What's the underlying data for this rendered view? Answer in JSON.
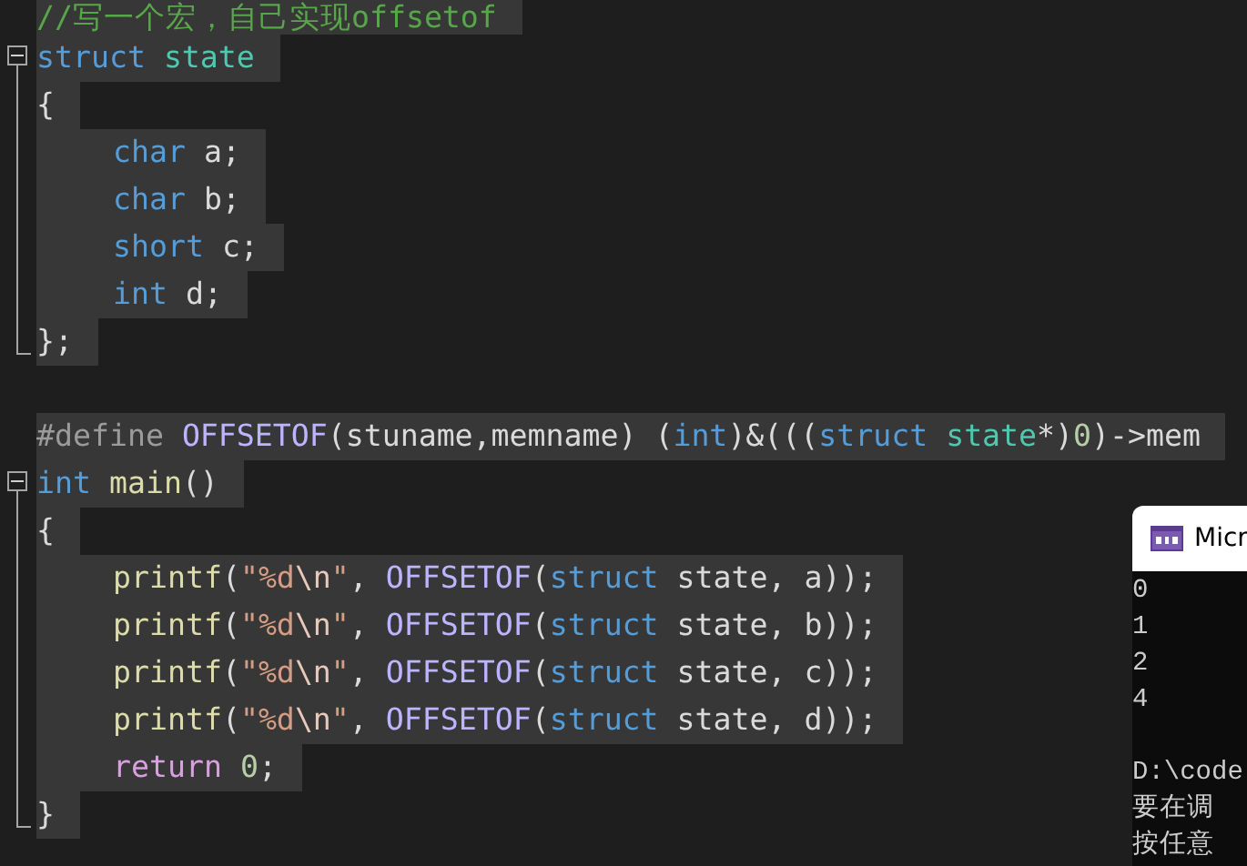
{
  "editor": {
    "lines": [
      {
        "kind": "plain",
        "selected": true,
        "tokens": [
          {
            "kind": "comment",
            "text": "//写一个宏，自己实现offsetof"
          }
        ]
      },
      {
        "kind": "start",
        "selected": true,
        "tokens": [
          {
            "kind": "keyword",
            "text": "struct "
          },
          {
            "kind": "type",
            "text": "state"
          }
        ]
      },
      {
        "kind": "body",
        "selected": true,
        "tokens": [
          {
            "kind": "plain",
            "text": "{"
          }
        ]
      },
      {
        "kind": "body",
        "selected": true,
        "indent": true,
        "tokens": [
          {
            "kind": "keyword",
            "text": "char"
          },
          {
            "kind": "plain",
            "text": " a;"
          }
        ]
      },
      {
        "kind": "body",
        "selected": true,
        "indent": true,
        "tokens": [
          {
            "kind": "keyword",
            "text": "char"
          },
          {
            "kind": "plain",
            "text": " b;"
          }
        ]
      },
      {
        "kind": "body",
        "selected": true,
        "indent": true,
        "tokens": [
          {
            "kind": "keyword",
            "text": "short"
          },
          {
            "kind": "plain",
            "text": " c;"
          }
        ]
      },
      {
        "kind": "body",
        "selected": true,
        "indent": true,
        "tokens": [
          {
            "kind": "keyword",
            "text": "int"
          },
          {
            "kind": "plain",
            "text": " d;"
          }
        ]
      },
      {
        "kind": "end",
        "selected": true,
        "tokens": [
          {
            "kind": "plain",
            "text": "};"
          }
        ]
      },
      {
        "kind": "plain"
      },
      {
        "kind": "plain",
        "selected": true,
        "tokens": [
          {
            "kind": "preproc",
            "text": "#define "
          },
          {
            "kind": "macro",
            "text": "OFFSETOF"
          },
          {
            "kind": "plain",
            "text": "(stuname,memname) ("
          },
          {
            "kind": "keyword",
            "text": "int"
          },
          {
            "kind": "plain",
            "text": ")&((("
          },
          {
            "kind": "keyword",
            "text": "struct "
          },
          {
            "kind": "type",
            "text": "state"
          },
          {
            "kind": "plain",
            "text": "*)"
          },
          {
            "kind": "number",
            "text": "0"
          },
          {
            "kind": "plain",
            "text": ")->mem"
          }
        ]
      },
      {
        "kind": "start",
        "selected": true,
        "tokens": [
          {
            "kind": "keyword",
            "text": "int "
          },
          {
            "kind": "function",
            "text": "main"
          },
          {
            "kind": "plain",
            "text": "()"
          }
        ]
      },
      {
        "kind": "body",
        "selected": true,
        "tokens": [
          {
            "kind": "plain",
            "text": "{"
          }
        ]
      },
      {
        "kind": "body",
        "selected": true,
        "indent": true,
        "tokens": [
          {
            "kind": "function",
            "text": "printf"
          },
          {
            "kind": "plain",
            "text": "("
          },
          {
            "kind": "string",
            "text": "\"%d"
          },
          {
            "kind": "escape",
            "text": "\\n"
          },
          {
            "kind": "string",
            "text": "\""
          },
          {
            "kind": "plain",
            "text": ", "
          },
          {
            "kind": "macro",
            "text": "OFFSETOF"
          },
          {
            "kind": "plain",
            "text": "("
          },
          {
            "kind": "keyword",
            "text": "struct"
          },
          {
            "kind": "plain",
            "text": " state, a));"
          }
        ]
      },
      {
        "kind": "body",
        "selected": true,
        "indent": true,
        "tokens": [
          {
            "kind": "function",
            "text": "printf"
          },
          {
            "kind": "plain",
            "text": "("
          },
          {
            "kind": "string",
            "text": "\"%d"
          },
          {
            "kind": "escape",
            "text": "\\n"
          },
          {
            "kind": "string",
            "text": "\""
          },
          {
            "kind": "plain",
            "text": ", "
          },
          {
            "kind": "macro",
            "text": "OFFSETOF"
          },
          {
            "kind": "plain",
            "text": "("
          },
          {
            "kind": "keyword",
            "text": "struct"
          },
          {
            "kind": "plain",
            "text": " state, b));"
          }
        ]
      },
      {
        "kind": "body",
        "selected": true,
        "indent": true,
        "tokens": [
          {
            "kind": "function",
            "text": "printf"
          },
          {
            "kind": "plain",
            "text": "("
          },
          {
            "kind": "string",
            "text": "\"%d"
          },
          {
            "kind": "escape",
            "text": "\\n"
          },
          {
            "kind": "string",
            "text": "\""
          },
          {
            "kind": "plain",
            "text": ", "
          },
          {
            "kind": "macro",
            "text": "OFFSETOF"
          },
          {
            "kind": "plain",
            "text": "("
          },
          {
            "kind": "keyword",
            "text": "struct"
          },
          {
            "kind": "plain",
            "text": " state, c));"
          }
        ]
      },
      {
        "kind": "body",
        "selected": true,
        "indent": true,
        "tokens": [
          {
            "kind": "function",
            "text": "printf"
          },
          {
            "kind": "plain",
            "text": "("
          },
          {
            "kind": "string",
            "text": "\"%d"
          },
          {
            "kind": "escape",
            "text": "\\n"
          },
          {
            "kind": "string",
            "text": "\""
          },
          {
            "kind": "plain",
            "text": ", "
          },
          {
            "kind": "macro",
            "text": "OFFSETOF"
          },
          {
            "kind": "plain",
            "text": "("
          },
          {
            "kind": "keyword",
            "text": "struct"
          },
          {
            "kind": "plain",
            "text": " state, d));"
          }
        ]
      },
      {
        "kind": "body",
        "selected": true,
        "indent": true,
        "tokens": [
          {
            "kind": "control",
            "text": "return "
          },
          {
            "kind": "number",
            "text": "0"
          },
          {
            "kind": "plain",
            "text": ";"
          }
        ]
      },
      {
        "kind": "end",
        "selected": true,
        "tokens": [
          {
            "kind": "plain",
            "text": "}"
          }
        ]
      }
    ]
  },
  "console": {
    "title": "Micr",
    "lines": [
      {
        "kind": "output",
        "text": "0"
      },
      {
        "kind": "output",
        "text": "1"
      },
      {
        "kind": "output",
        "text": "2"
      },
      {
        "kind": "output",
        "text": "4"
      },
      {
        "kind": "blank"
      },
      {
        "kind": "output",
        "text": "D:\\code"
      },
      {
        "kind": "output",
        "text": "要在调"
      },
      {
        "kind": "output",
        "text": "按任意"
      }
    ]
  }
}
